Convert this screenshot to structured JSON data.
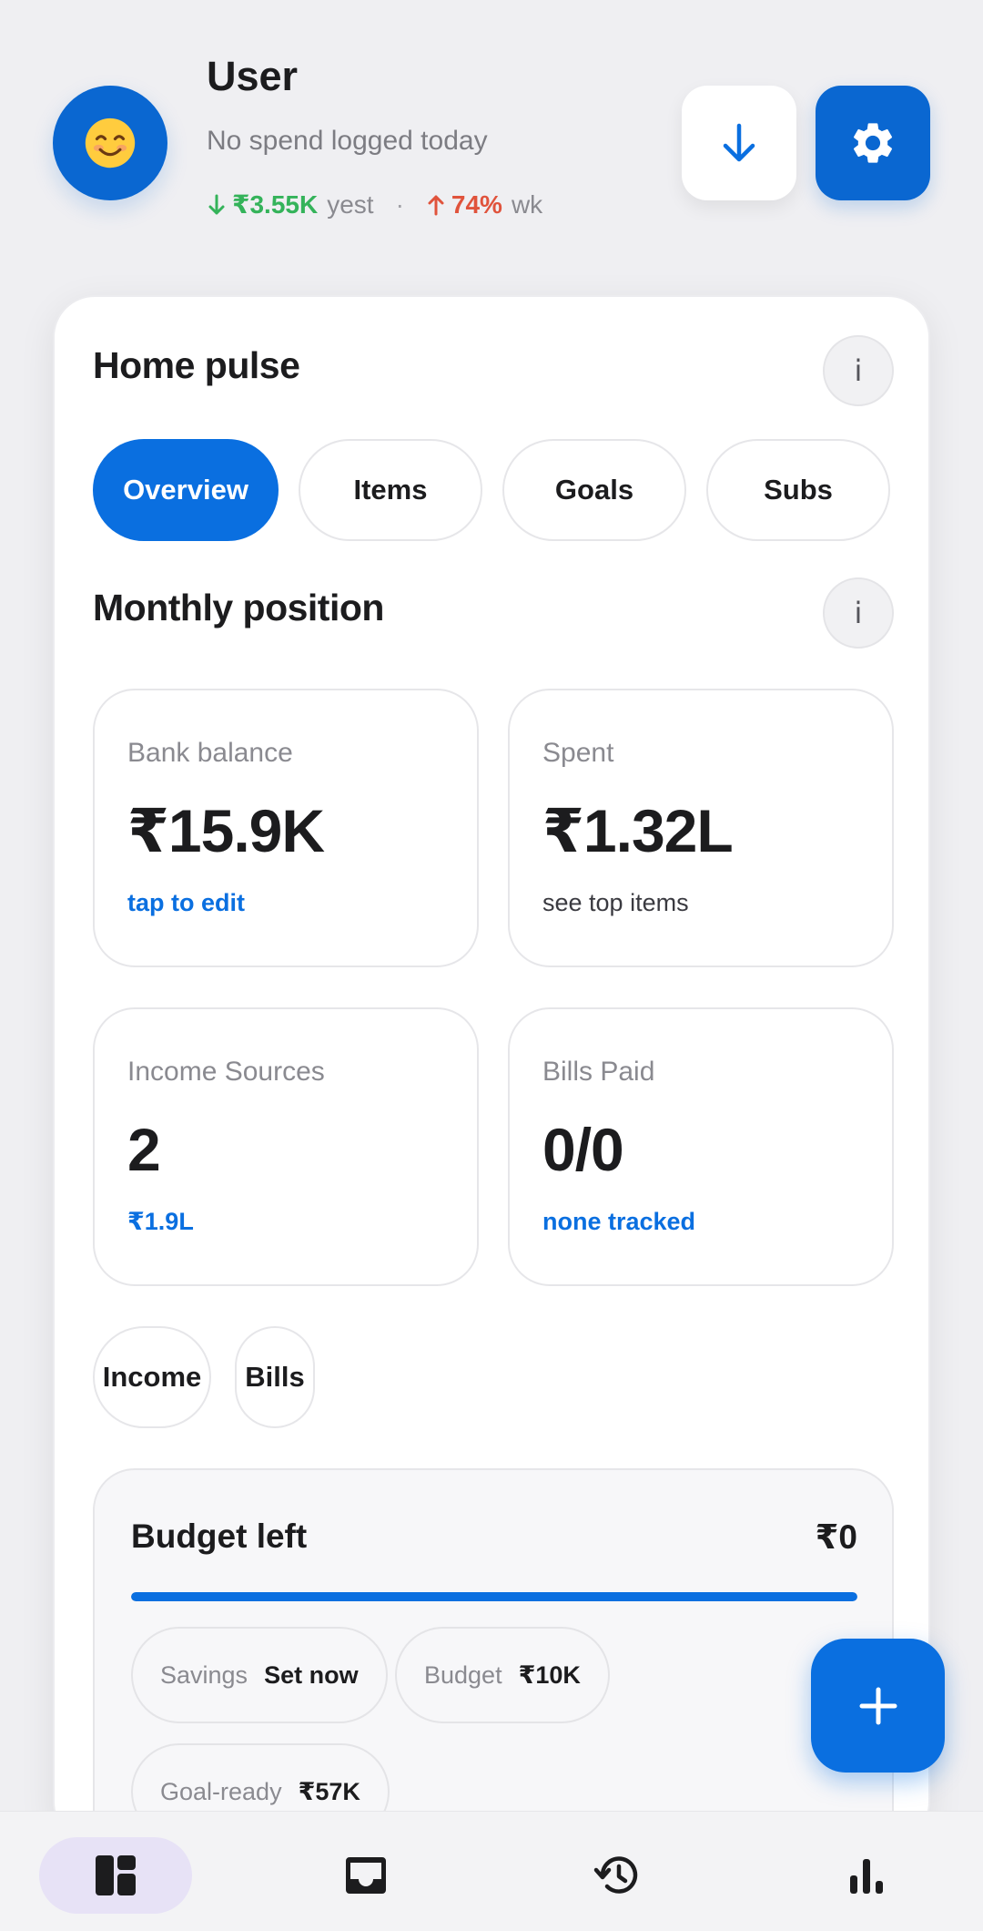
{
  "header": {
    "user_name": "User",
    "subtitle": "No spend logged today",
    "yesterday": {
      "value": "₹3.55K",
      "label": "yest",
      "direction": "down",
      "color": "#34b35a"
    },
    "separator": "·",
    "weekly": {
      "value": "74%",
      "label": "wk",
      "direction": "up",
      "color": "#e0533c"
    },
    "avatar_icon": "smiling-face-icon",
    "download_icon": "arrow-down-icon",
    "settings_icon": "gear-icon"
  },
  "home_pulse": {
    "title": "Home pulse",
    "info_label": "i",
    "tabs": [
      {
        "label": "Overview",
        "active": true
      },
      {
        "label": "Items",
        "active": false
      },
      {
        "label": "Goals",
        "active": false
      },
      {
        "label": "Subs",
        "active": false
      }
    ]
  },
  "monthly_position": {
    "title": "Monthly position",
    "info_label": "i",
    "cards": [
      {
        "label": "Bank balance",
        "value": "₹15.9K",
        "link": "tap to edit"
      },
      {
        "label": "Spent",
        "value": "₹1.32L",
        "link": "see top items"
      },
      {
        "label": "Income Sources",
        "value": "2",
        "link": "₹1.9L"
      },
      {
        "label": "Bills Paid",
        "value": "0/0",
        "link": "none tracked"
      }
    ],
    "chips": [
      {
        "label": "Income"
      },
      {
        "label": "Bills"
      }
    ]
  },
  "budget": {
    "title": "Budget left",
    "amount": "₹0",
    "progress": 1.0,
    "accent": "#0a6fe0",
    "pills": [
      {
        "label": "Savings",
        "value": "Set now"
      },
      {
        "label": "Budget",
        "value": "₹10K"
      },
      {
        "label": "Goal-ready",
        "value": "₹57K"
      }
    ]
  },
  "fab": {
    "icon": "plus-icon"
  },
  "bottom_nav": [
    {
      "icon": "dashboard-icon",
      "active": true
    },
    {
      "icon": "inbox-icon",
      "active": false
    },
    {
      "icon": "history-icon",
      "active": false
    },
    {
      "icon": "bar-chart-icon",
      "active": false
    }
  ],
  "colors": {
    "primary": "#0a6fe0",
    "avatar": "#0a67d1",
    "nav_active_bg": "#e7e2f6"
  }
}
